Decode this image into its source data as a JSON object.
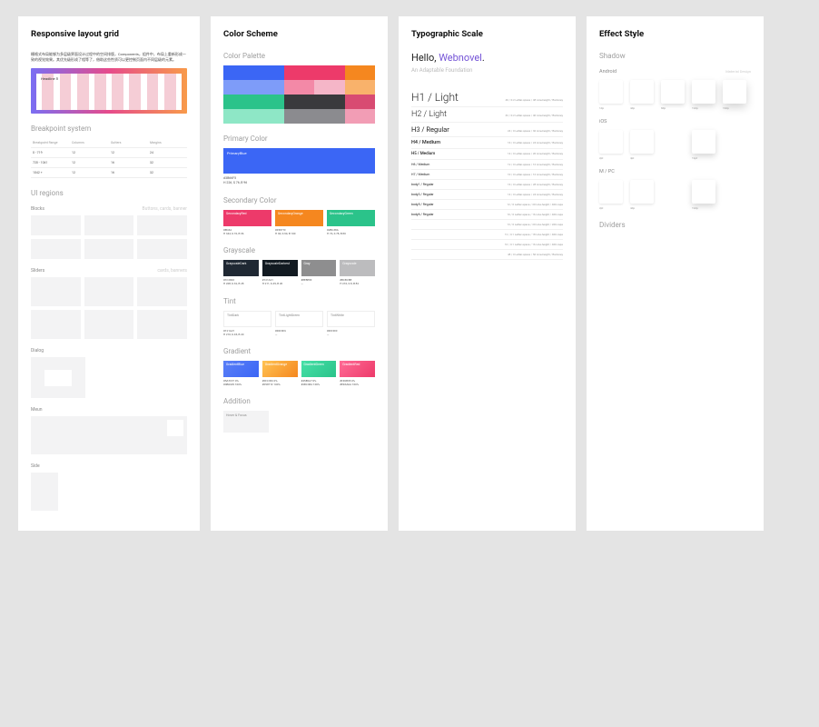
{
  "panels": {
    "grid": {
      "title": "Responsive layout grid",
      "desc": "栅格式布局能够为多层级界面设计过程中的空间排版，Components，组件中，布局上重新形成一致的视觉效果。其优先级形成了相等了，借助这些性质可以更控制页面内不同层级的元素。",
      "preview_headline": "Headline 5",
      "breakpoint_title": "Breakpoint system",
      "bp_headers": [
        "Breakpoint Range",
        "Columns",
        "Gutters",
        "Margins"
      ],
      "bp_rows": [
        [
          "0 - 719",
          "12",
          "12",
          "24"
        ],
        [
          "720 - 1041",
          "12",
          "16",
          "32"
        ],
        [
          "1042 +",
          "12",
          "16",
          "32"
        ]
      ],
      "ui_regions_title": "UI regions",
      "blocks": {
        "label": "Blocks",
        "hint": "Buttons, cards, banner"
      },
      "sliders": {
        "label": "Sliders",
        "hint": "cards, banners"
      },
      "dialog": {
        "label": "Dialog"
      },
      "menu": {
        "label": "Meun"
      },
      "side": {
        "label": "Side"
      }
    },
    "color": {
      "title": "Color Scheme",
      "palette_title": "Color Palette",
      "palette": [
        "#3b66f5",
        "#3b66f5",
        "#ed3a6a",
        "#ed3a6a",
        "#f5871f",
        "#7e9cf9",
        "#7e9cf9",
        "#f389a7",
        "#f5b6c8",
        "#f9b26b",
        "#2bc38a",
        "#2bc38a",
        "#3a3a3d",
        "#3a3a3d",
        "#d84b72",
        "#8ee7c6",
        "#8ee7c6",
        "#8b8b8f",
        "#8b8b8f",
        "#f29db5"
      ],
      "primary_title": "Primary Color",
      "primary": {
        "name": "PrimaryBlue",
        "hex": "#3B66F5",
        "hsb": "H 226, S 76, B 96"
      },
      "secondary_title": "Secondary Color",
      "secondary": [
        {
          "name": "SecondaryRed",
          "bg": "#ed3a6a",
          "hex": "#ED3A",
          "hsb": "H 344, S 76, B 96"
        },
        {
          "name": "SecondaryOrange",
          "bg": "#f5871f",
          "hex": "#F5871F",
          "hsb": "H 30, S 90, B 100"
        },
        {
          "name": "SecondaryGreen",
          "bg": "#2bc38a",
          "hex": "#2BC38A",
          "hsb": "H 76, S 78, B 80"
        }
      ],
      "grayscale_title": "Grayscale",
      "grayscale": [
        {
          "name": "GrayscaleDark",
          "bg": "#1f2833",
          "hex": "#1F2833",
          "hsb": "H 208, S 32, B 28"
        },
        {
          "name": "GrayscaleDarkest",
          "bg": "#121a21",
          "hex": "#121A21",
          "hsb": "H 211, S 45, B 20"
        },
        {
          "name": "Gray",
          "bg": "#8e8e8f",
          "hex": "#8E8E8F",
          "hsb": "—"
        },
        {
          "name": "Grayscale",
          "bg": "#bcbcbe",
          "hex": "#BCBCBE",
          "hsb": "H 210, S 8, B 82"
        }
      ],
      "tint_title": "Tint",
      "tint": [
        {
          "name": "TintDark",
          "hex": "#121A21",
          "hsb": "H 210, S 45, B 20"
        },
        {
          "name": "TintLightGreen",
          "hex": "#F0F9F6",
          "hsb": "—"
        },
        {
          "name": "TintWhite",
          "hex": "#FFFFFF",
          "hsb": "—"
        }
      ],
      "gradient_title": "Gradient",
      "gradient": [
        {
          "name": "GradientBlue",
          "css": "linear-gradient(135deg,#5a7ff7,#3b66f5)",
          "l1": "#5A7FF7 0%",
          "l2": "#3B66F5 100%"
        },
        {
          "name": "GradientOrange",
          "css": "linear-gradient(135deg,#ffc352,#f5871f)",
          "l1": "#FFC352 0%",
          "l2": "#F5871F 100%"
        },
        {
          "name": "GradientGreen",
          "css": "linear-gradient(135deg,#45e0a7,#2bc38a)",
          "l1": "#45E0A7 0%",
          "l2": "#2BC38A 100%"
        },
        {
          "name": "GradientRed",
          "css": "linear-gradient(135deg,#ff6b95,#ed3a6a)",
          "l1": "#FF6B95 0%",
          "l2": "#ED3A6A 100%"
        }
      ],
      "addition_title": "Addition",
      "addition_label": "Hover & Focus"
    },
    "type": {
      "title": "Typographic Scale",
      "hello_pre": "Hello, ",
      "hello_brand": "Webnovel",
      "hello_suffix": ".",
      "subtitle": "An Adaptable Foundation",
      "rows": [
        {
          "label": "H1 / Light",
          "cls": "t-h1",
          "det": "40 / 0.2 Letter-space / 48 Line-height / Barloney"
        },
        {
          "label": "H2 / Light",
          "cls": "t-h2",
          "det": "32 / 0.2 Letter-space / 40 Line-height / Barloney"
        },
        {
          "label": "H3 / Regular",
          "cls": "t-h3",
          "det": "24 / 0 Letter-space / 36 Line-height / Barloney"
        },
        {
          "label": "H4 / Medium",
          "cls": "t-h4",
          "det": "16 / 0 Letter-space / 24 Line-height / Barloney"
        },
        {
          "label": "H5 / Medium",
          "cls": "t-h5",
          "det": "14 / 0 Letter-space / 20 Line-height / Barloney"
        },
        {
          "label": "H6 / Medium",
          "cls": "t-sm",
          "det": "12 / 0 Letter-space / 16 Line-height / Barloney"
        },
        {
          "label": "H7 / Medium",
          "cls": "t-sm",
          "det": "10 / 0 Letter-space / 16 Line-height / Barloney"
        },
        {
          "label": "body1 / Regular",
          "cls": "t-sm",
          "det": "16 / 0 Letter-space / 28 Line-height / Barloney"
        },
        {
          "label": "body3 / Regular",
          "cls": "t-sm",
          "det": "14 / 0 Letter-space / 24 Line-height / Barloney"
        },
        {
          "label": "body5 / Regular",
          "cls": "t-sm",
          "det": "12 / 0 Letter-space / 20 Line-height / 400 caps"
        },
        {
          "label": "body6 / Regular",
          "cls": "t-sm",
          "det": "10 / 0 Letter-space / 16 Line-height / 400 caps"
        },
        {
          "label": "",
          "cls": "t-sm",
          "det": "13 / 0 Letter-space / 20 Line-height / 200 caps"
        },
        {
          "label": "",
          "cls": "t-sm",
          "det": "12 / 0.1 Letter-space / 18 Line-height / 400 caps"
        },
        {
          "label": "",
          "cls": "t-sm",
          "det": "10 / 0.1 Letter-space / 16 Line-height / 400 caps"
        },
        {
          "label": "",
          "cls": "t-sm",
          "det": "48 / 0 Letter-space / 56 Line-height / Barloney"
        }
      ]
    },
    "effect": {
      "title": "Effect Style",
      "shadow_title": "Shadow",
      "android": {
        "label": "Android",
        "hint": "Material Design",
        "items": [
          "1dp",
          "4dp",
          "8dp",
          "12dp",
          "16dp"
        ]
      },
      "ios": {
        "label": "iOS",
        "items": [
          "2pt",
          "4pt",
          "",
          "12pt",
          ""
        ]
      },
      "mpc": {
        "label": "M / PC",
        "items": [
          "2pt",
          "4dp",
          "",
          "12dp",
          ""
        ]
      },
      "dividers_title": "Dividers"
    }
  }
}
